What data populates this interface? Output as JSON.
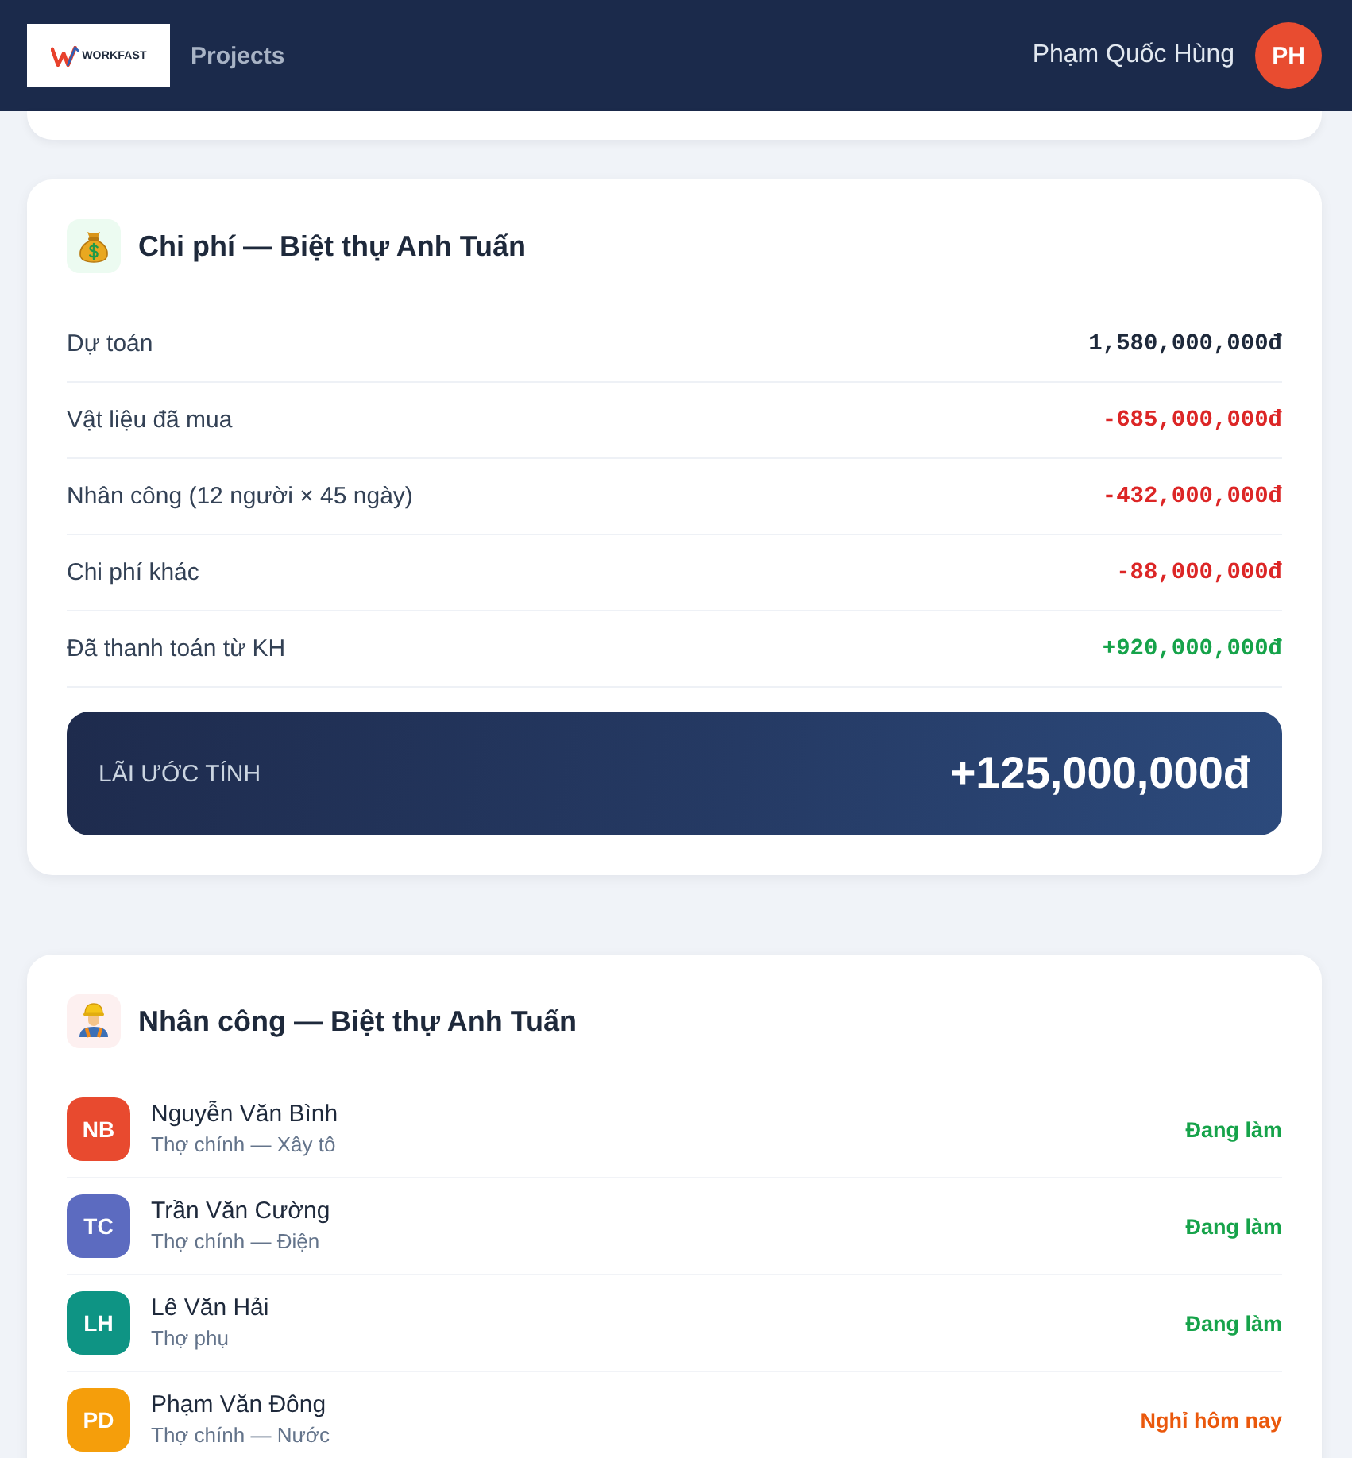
{
  "header": {
    "logo_text": "WORKFAST",
    "nav_link": "Projects",
    "user_name": "Phạm Quốc Hùng",
    "user_initials": "PH"
  },
  "cost_card": {
    "title": "Chi phí — Biệt thự Anh Tuấn",
    "rows": [
      {
        "label": "Dự toán",
        "value": "1,580,000,000đ",
        "kind": "neutral"
      },
      {
        "label": "Vật liệu đã mua",
        "value": "-685,000,000đ",
        "kind": "expense"
      },
      {
        "label": "Nhân công (12 người × 45 ngày)",
        "value": "-432,000,000đ",
        "kind": "expense"
      },
      {
        "label": "Chi phí khác",
        "value": "-88,000,000đ",
        "kind": "expense"
      },
      {
        "label": "Đã thanh toán từ KH",
        "value": "+920,000,000đ",
        "kind": "income"
      }
    ],
    "profit": {
      "label": "LÃI ƯỚC TÍNH",
      "value": "+125,000,000đ"
    }
  },
  "labor_card": {
    "title": "Nhân công — Biệt thự Anh Tuấn",
    "workers": [
      {
        "initials": "NB",
        "name": "Nguyễn Văn Bình",
        "role": "Thợ chính — Xây tô",
        "color": "#e84a2f",
        "status": "Đang làm",
        "on_leave": false
      },
      {
        "initials": "TC",
        "name": "Trần Văn Cường",
        "role": "Thợ chính — Điện",
        "color": "#5c6bc0",
        "status": "Đang làm",
        "on_leave": false
      },
      {
        "initials": "LH",
        "name": "Lê Văn Hải",
        "role": "Thợ phụ",
        "color": "#0e9484",
        "status": "Đang làm",
        "on_leave": false
      },
      {
        "initials": "PD",
        "name": "Phạm Văn Đông",
        "role": "Thợ chính — Nước",
        "color": "#f59e0b",
        "status": "Nghỉ hôm nay",
        "on_leave": true
      }
    ]
  }
}
